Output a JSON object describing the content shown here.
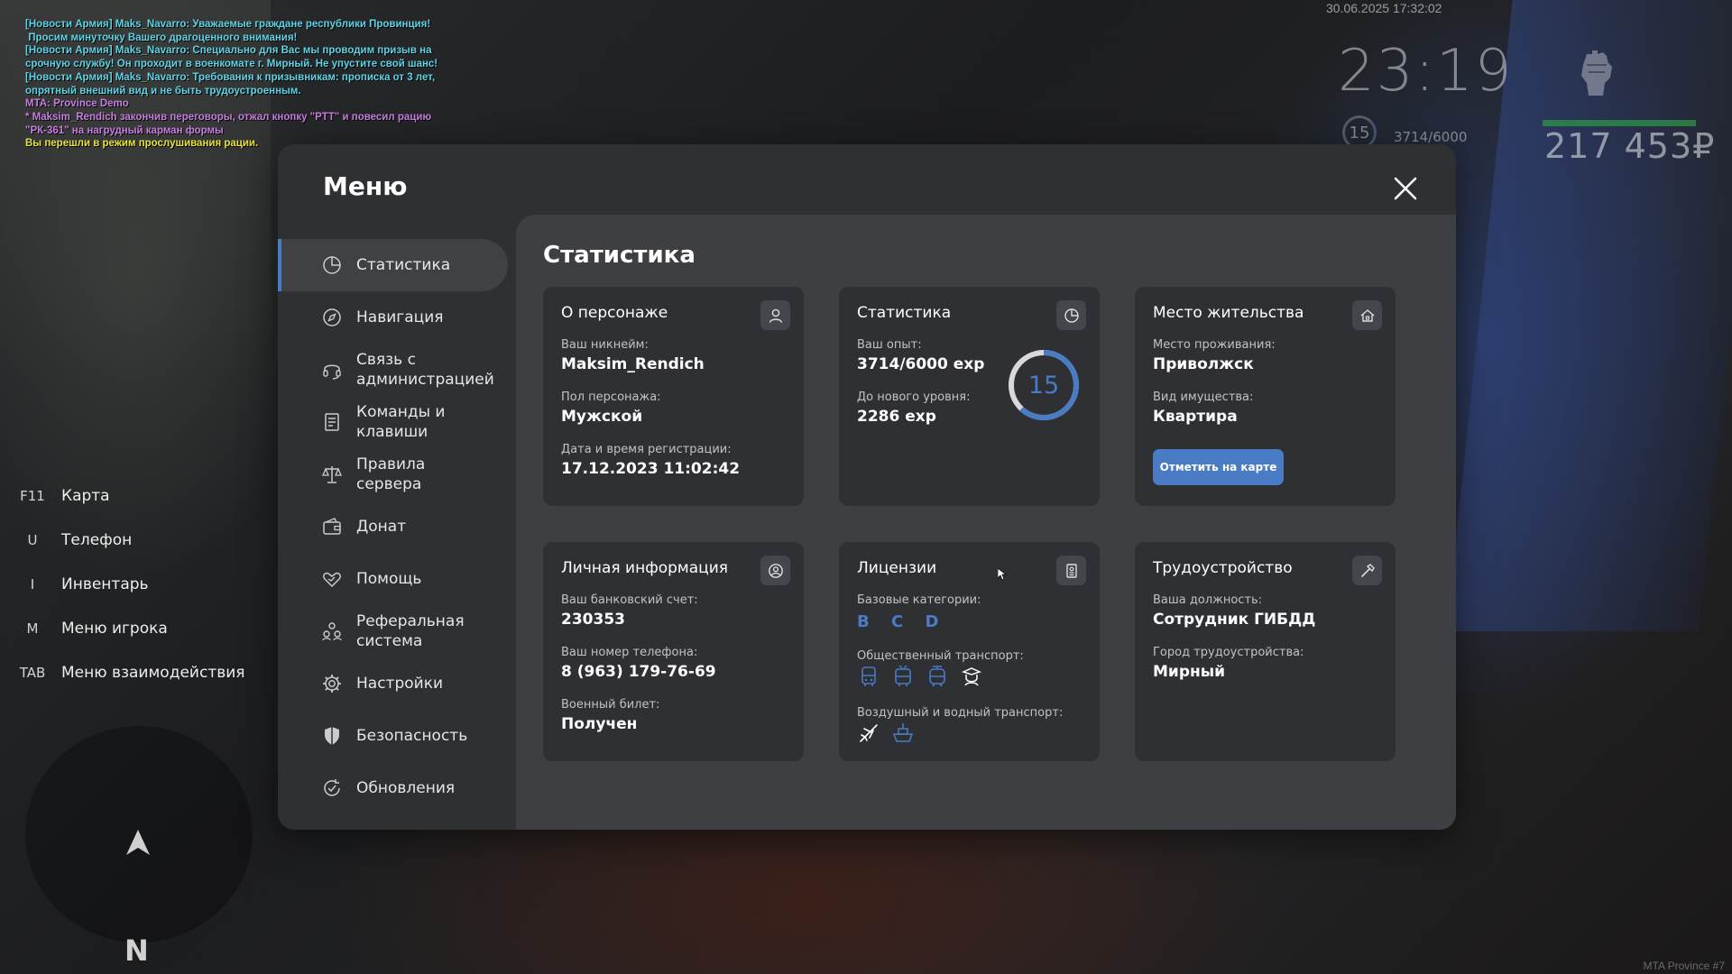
{
  "chat": [
    {
      "text": "[Новости Армия] Maks_Navarro: Уважаемые граждане республики Провинция!",
      "color": "#5fd4e6"
    },
    {
      "text": " Просим минуточку Вашего драгоценного внимания!",
      "color": "#5fd4e6"
    },
    {
      "text": "[Новости Армия] Maks_Navarro: Специально для Вас мы проводим призыв на срочную службу! Он проходит в военкомате г. Мирный. Не упустите свой шанс!",
      "color": "#5fd4e6"
    },
    {
      "text": "[Новости Армия] Maks_Navarro: Требования к призывникам: прописка от 3 лет, опрятный внешний вид и не быть трудоустроенным.",
      "color": "#5fd4e6"
    },
    {
      "text": "MTA: Province Demo",
      "color": "#c77ddf"
    },
    {
      "text": "* Maksim_Rendich закончив переговоры, отжал кнопку \"PTT\" и повесил рацию \"РК-361\" на нагрудный карман формы",
      "color": "#c77ddf"
    },
    {
      "text": "Вы перешли в режим прослушивания рации.",
      "color": "#e8e23c"
    }
  ],
  "hud": {
    "datetime": "30.06.2025 17:32:02",
    "clock": "23:19",
    "level": "15",
    "exp": "3714/6000",
    "money": "217 453₽",
    "server": "MTA Province #7",
    "health_pct": 100
  },
  "keybinds": [
    {
      "key": "F11",
      "label": "Карта"
    },
    {
      "key": "U",
      "label": "Телефон"
    },
    {
      "key": "I",
      "label": "Инвентарь"
    },
    {
      "key": "M",
      "label": "Меню игрока"
    },
    {
      "key": "TAB",
      "label": "Меню взаимодействия"
    }
  ],
  "minimap": {
    "north": "N"
  },
  "menu": {
    "title": "Меню",
    "nav": [
      {
        "label": "Статистика",
        "icon": "pie-chart-icon",
        "active": true
      },
      {
        "label": "Навигация",
        "icon": "compass-icon"
      },
      {
        "label": "Связь с администрацией",
        "icon": "headset-icon"
      },
      {
        "label": "Команды и клавиши",
        "icon": "document-icon"
      },
      {
        "label": "Правила сервера",
        "icon": "scales-icon"
      },
      {
        "label": "Донат",
        "icon": "wallet-icon"
      },
      {
        "label": "Помощь",
        "icon": "heart-hand-icon"
      },
      {
        "label": "Реферальная система",
        "icon": "people-icon"
      },
      {
        "label": "Настройки",
        "icon": "gear-icon"
      },
      {
        "label": "Безопасность",
        "icon": "shield-icon"
      },
      {
        "label": "Обновления",
        "icon": "refresh-check-icon"
      }
    ]
  },
  "stats": {
    "title": "Статистика",
    "about": {
      "title": "О персонаже",
      "nickname_label": "Ваш никнейм:",
      "nickname": "Maksim_Rendich",
      "gender_label": "Пол персонажа:",
      "gender": "Мужской",
      "reg_label": "Дата и время регистрации:",
      "reg": "17.12.2023 11:02:42"
    },
    "statistics": {
      "title": "Статистика",
      "exp_label": "Ваш опыт:",
      "exp": "3714/6000 exp",
      "next_label": "До нового уровня:",
      "next": "2286 exp",
      "level": "15",
      "progress": 0.619
    },
    "residence": {
      "title": "Место жительства",
      "place_label": "Место проживания:",
      "place": "Приволжск",
      "type_label": "Вид имущества:",
      "type": "Квартира",
      "button": "Отметить на карте"
    },
    "personal": {
      "title": "Личная информация",
      "bank_label": "Ваш банковский счет:",
      "bank": "230353",
      "phone_label": "Ваш номер телефона:",
      "phone": "8 (963) 179-76-69",
      "military_label": "Военный билет:",
      "military": "Получен"
    },
    "licenses": {
      "title": "Лицензии",
      "base_label": "Базовые категории:",
      "base": "B C D",
      "public_label": "Общественный транспорт:",
      "air_label": "Воздушный и водный транспорт:"
    },
    "employment": {
      "title": "Трудоустройство",
      "position_label": "Ваша должность:",
      "position": "Сотрудник ГИБДД",
      "city_label": "Город трудоустройства:",
      "city": "Мирный"
    }
  },
  "colors": {
    "accent": "#4a7bc5",
    "modal": "#2f3032",
    "content": "#3e3f42"
  }
}
